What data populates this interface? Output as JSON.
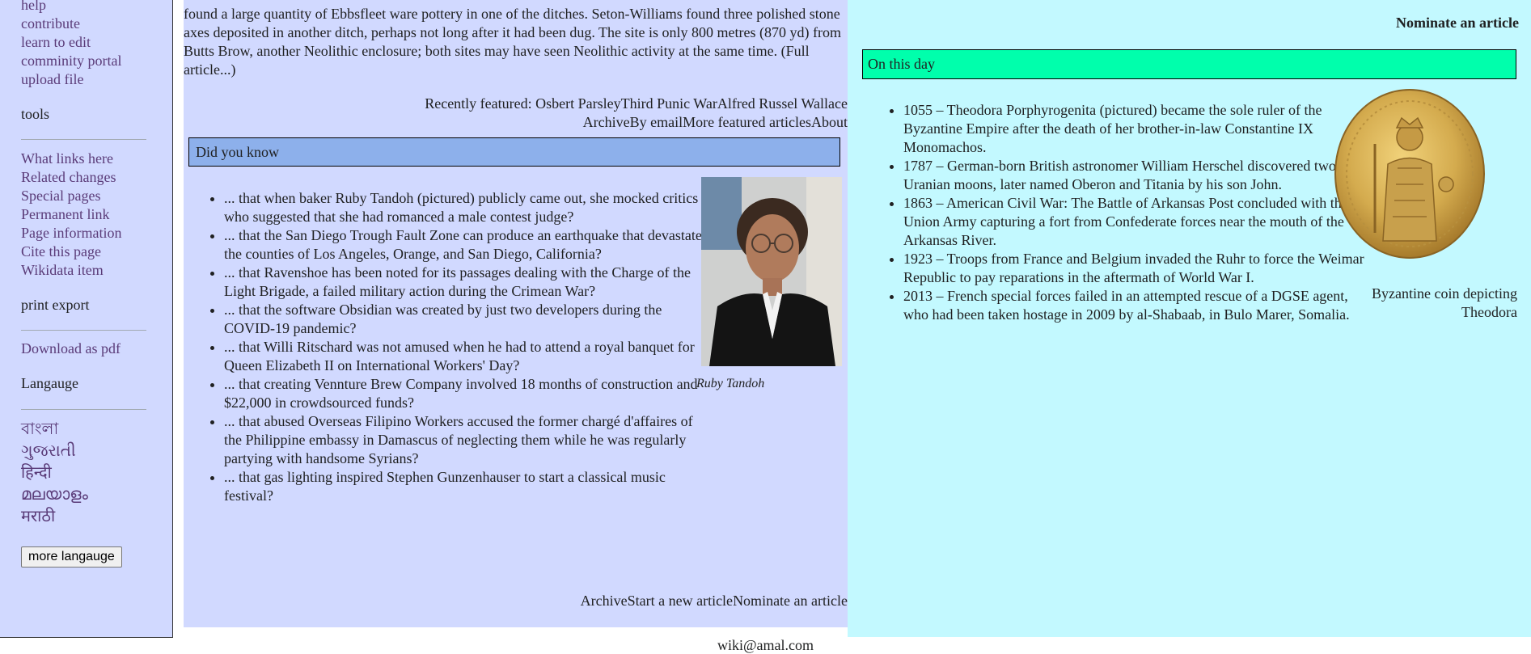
{
  "sidebar": {
    "links_top": [
      "help",
      "contribute",
      "learn to edit",
      "comminity portal",
      "upload file"
    ],
    "tools_heading": "tools",
    "tools_links": [
      "What links here",
      "Related changes",
      "Special pages",
      "Permanent link",
      "Page information",
      "Cite this page",
      "Wikidata item"
    ],
    "print_heading": "print export",
    "print_links": [
      "Download as pdf"
    ],
    "language_heading": "Langauge",
    "languages": [
      "বাংলা",
      "ગુજરાતી",
      "हिन्दी",
      "മലയാളം",
      "मराठी"
    ],
    "more_button": "more langauge"
  },
  "featured": {
    "text": "found a large quantity of Ebbsfleet ware pottery in one of the ditches. Seton-Williams found three polished stone axes deposited in another ditch, perhaps not long after it had been dug. The site is only 800 metres (870 yd) from Butts Brow, another Neolithic enclosure; both sites may have seen Neolithic activity at the same time. (Full article...)",
    "recently_label": "Recently featured: ",
    "recently": [
      "Osbert Parsley",
      "Third Punic War",
      "Alfred Russel Wallace"
    ],
    "links": [
      "Archive",
      "By email",
      "More featured articles",
      "About"
    ]
  },
  "dyk": {
    "header": "Did you know",
    "items": [
      "... that when baker Ruby Tandoh (pictured) publicly came out, she mocked critics who suggested that she had romanced a male contest judge?",
      "... that the San Diego Trough Fault Zone can produce an earthquake that devastates the counties of Los Angeles, Orange, and San Diego, California?",
      "... that Ravenshoe has been noted for its passages dealing with the Charge of the Light Brigade, a failed military action during the Crimean War?",
      "... that the software Obsidian was created by just two developers during the COVID-19 pandemic?",
      "... that Willi Ritschard was not amused when he had to attend a royal banquet for Queen Elizabeth II on International Workers' Day?",
      "... that creating Vennture Brew Company involved 18 months of construction and $22,000 in crowdsourced funds?",
      "... that abused Overseas Filipino Workers accused the former chargé d'affaires of the Philippine embassy in Damascus of neglecting them while he was regularly partying with handsome Syrians?",
      "... that gas lighting inspired Stephen Gunzenhauser to start a classical music festival?"
    ],
    "photo_caption": "Ruby Tandoh",
    "footer_links": [
      "Archive",
      "Start a new article",
      "Nominate an article"
    ]
  },
  "otd": {
    "nominate": "Nominate an article",
    "header": "On this day",
    "items": [
      "1055 – Theodora Porphyrogenita (pictured) became the sole ruler of the Byzantine Empire after the death of her brother-in-law Constantine IX Monomachos.",
      "1787 – German-born British astronomer William Herschel discovered two Uranian moons, later named Oberon and Titania by his son John.",
      "1863 – American Civil War: The Battle of Arkansas Post concluded with the Union Army capturing a fort from Confederate forces near the mouth of the Arkansas River.",
      "1923 – Troops from France and Belgium invaded the Ruhr to force the Weimar Republic to pay reparations in the aftermath of World War I.",
      "2013 – French special forces failed in an attempted rescue of a DGSE agent, who had been taken hostage in 2009 by al-Shabaab, in Bulo Marer, Somalia."
    ],
    "coin_caption": "Byzantine coin depicting Theodora"
  },
  "footer": {
    "email": "wiki@amal.com"
  },
  "colors": {
    "sidebar_bg": "#d1d9ff",
    "center_bg": "#d1d9ff",
    "right_bg": "#c3f9ff",
    "dyk_header_bg": "#8db0eb",
    "otd_header_bg": "#00ffac",
    "link": "#5a3b78"
  }
}
